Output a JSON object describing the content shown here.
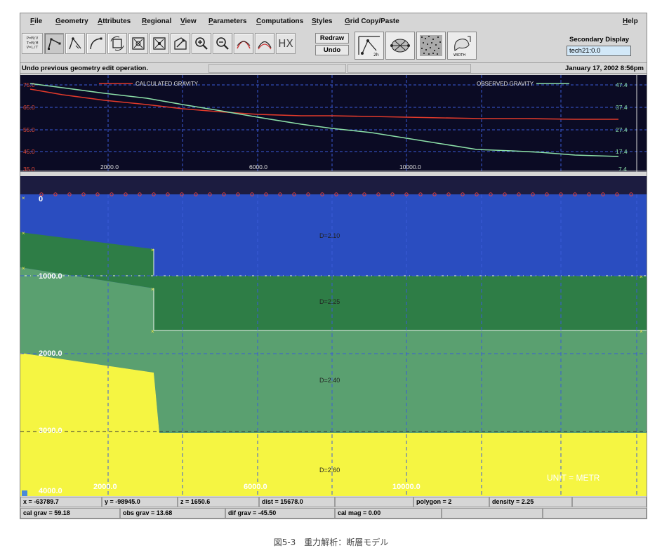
{
  "menu": {
    "items": [
      "File",
      "Geometry",
      "Attributes",
      "Regional",
      "View",
      "Parameters",
      "Computations",
      "Styles",
      "Grid Copy/Paste"
    ],
    "help": "Help"
  },
  "toolbar": {
    "pos_icon_lines": [
      "P=M/V",
      "T=M/M",
      "V=L/T"
    ],
    "tool_icons": [
      "draw-polygon-icon",
      "draw-polygon-alt-icon",
      "draw-arc-icon",
      "rotate-icon",
      "move-icon",
      "target-icon",
      "reshape-icon",
      "zoom-in-icon",
      "zoom-out-icon",
      "curve-icon",
      "curve-alt-icon",
      "hx-icon"
    ],
    "hx_label": "HX",
    "redraw_label": "Redraw",
    "undo_label": "Undo",
    "width_label": "WIDTH",
    "secondary_label": "Secondary Display",
    "secondary_value": "tech21:0.0"
  },
  "message": {
    "text": "Undo previous geometry edit operation.",
    "date": "January 17, 2002 8:56pm"
  },
  "gravity": {
    "calc_label": "CALCULATED GRAVITY",
    "obs_label": "OBSERVED GRAVITY",
    "left_ticks": [
      "75.0",
      "65.0",
      "55.0",
      "45.0",
      "35.0"
    ],
    "right_ticks": [
      "47.4",
      "37.4",
      "27.4",
      "17.4",
      "7.4"
    ],
    "x_ticks": [
      "2000.0",
      "6000.0",
      "10000.0"
    ],
    "calc_color": "#e23a2a",
    "obs_color": "#8ce0a8"
  },
  "section": {
    "y_ticks": [
      "0",
      "1000.0",
      "2000.0",
      "3000.0",
      "4000.0"
    ],
    "x_ticks": [
      "2000.0",
      "6000.0",
      "10000.0"
    ],
    "density_labels": [
      "D=2.10",
      "D=2.25",
      "D=2.40",
      "D=2.60"
    ],
    "units_label": "UNIT = METR",
    "colors": {
      "blue": "#2a4dc0",
      "dark_green": "#2e7d46",
      "mid_green": "#5aa070",
      "yellow": "#f5f542"
    }
  },
  "status": {
    "row1": [
      "x = -63789.7",
      "y = -98945.0",
      "z = 1650.6",
      "dist = 15678.0",
      "",
      "polygon = 2",
      "density = 2.25"
    ],
    "row2": [
      "cal grav = 59.18",
      "obs grav = 13.68",
      "dif grav = -45.50",
      "cal mag = 0.00"
    ]
  },
  "caption": "図5-3　重力解析：断層モデル"
}
